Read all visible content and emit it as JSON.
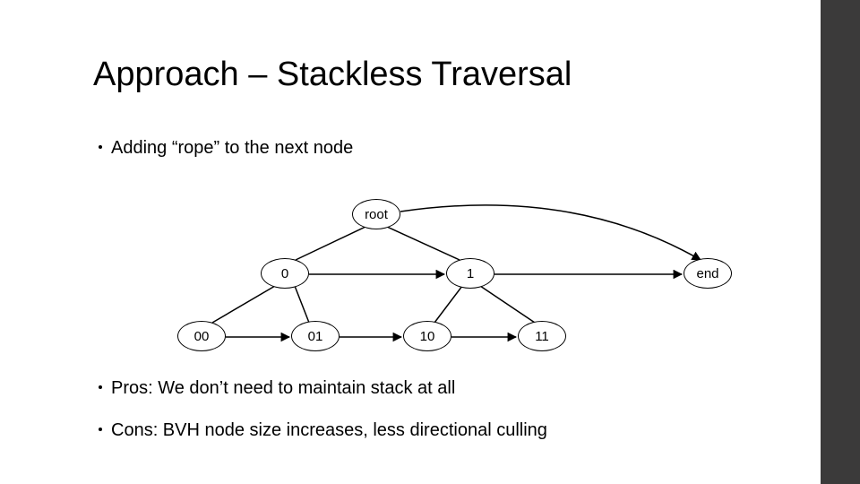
{
  "title": "Approach – Stackless Traversal",
  "bullets": {
    "b1": "Adding “rope” to the next node",
    "b2": "Pros: We don’t need to maintain stack at all",
    "b3": "Cons: BVH node size increases, less directional culling"
  },
  "tree": {
    "root": "root",
    "n0": "0",
    "n1": "1",
    "end": "end",
    "n00": "00",
    "n01": "01",
    "n10": "10",
    "n11": "11"
  },
  "chart_data": {
    "type": "tree",
    "nodes": [
      {
        "id": "root",
        "label": "root",
        "level": 0
      },
      {
        "id": "0",
        "label": "0",
        "level": 1
      },
      {
        "id": "1",
        "label": "1",
        "level": 1
      },
      {
        "id": "end",
        "label": "end",
        "level": 1,
        "terminal": true
      },
      {
        "id": "00",
        "label": "00",
        "level": 2
      },
      {
        "id": "01",
        "label": "01",
        "level": 2
      },
      {
        "id": "10",
        "label": "10",
        "level": 2
      },
      {
        "id": "11",
        "label": "11",
        "level": 2
      }
    ],
    "children_edges": [
      [
        "root",
        "0"
      ],
      [
        "root",
        "1"
      ],
      [
        "0",
        "00"
      ],
      [
        "0",
        "01"
      ],
      [
        "1",
        "10"
      ],
      [
        "1",
        "11"
      ]
    ],
    "rope_edges": [
      [
        "root",
        "end"
      ],
      [
        "0",
        "1"
      ],
      [
        "1",
        "end"
      ],
      [
        "00",
        "01"
      ],
      [
        "01",
        "10"
      ],
      [
        "10",
        "11"
      ]
    ]
  }
}
